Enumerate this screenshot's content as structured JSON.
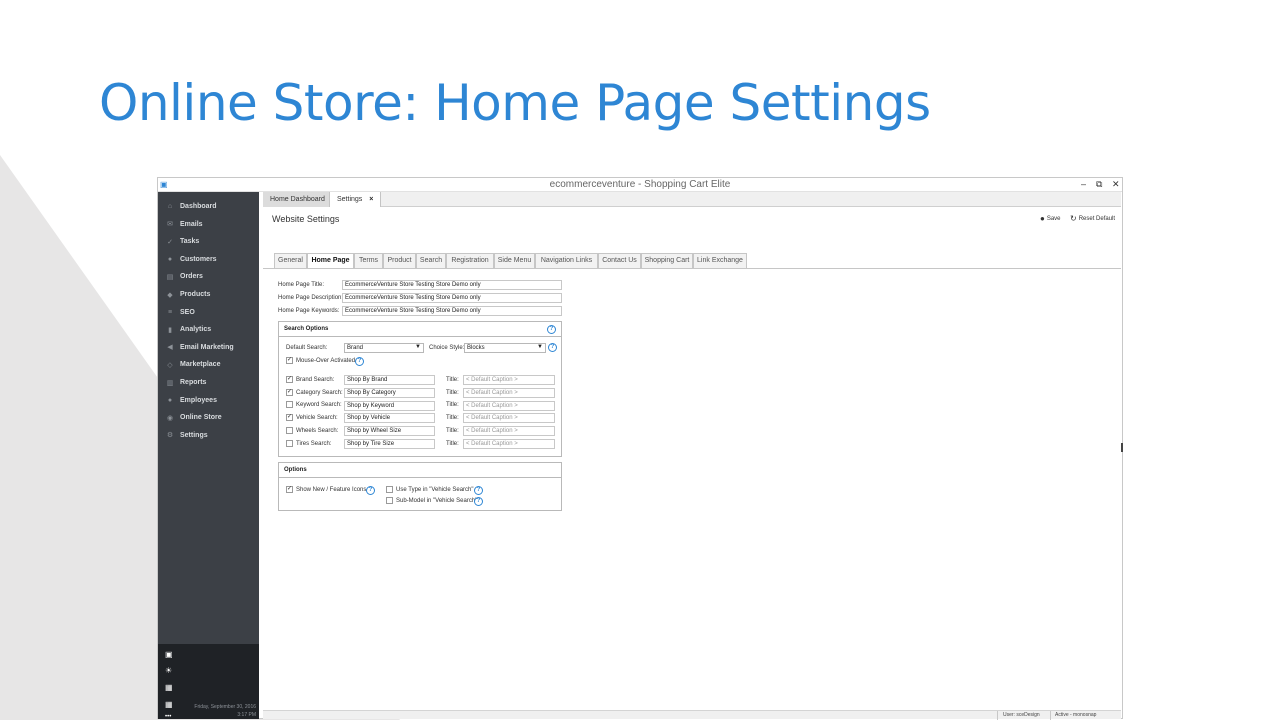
{
  "slide": {
    "title": "Online Store: Home Page Settings"
  },
  "window": {
    "title": "ecommerceventure - Shopping Cart Elite",
    "minimize": "–",
    "restore": "⧉",
    "close": "✕"
  },
  "sidebar": {
    "items": [
      {
        "label": "Dashboard",
        "icon": "dashboard-icon",
        "glyph": "⌂"
      },
      {
        "label": "Emails",
        "icon": "email-icon",
        "glyph": "✉"
      },
      {
        "label": "Tasks",
        "icon": "tasks-icon",
        "glyph": "✓"
      },
      {
        "label": "Customers",
        "icon": "customers-icon",
        "glyph": "●"
      },
      {
        "label": "Orders",
        "icon": "orders-icon",
        "glyph": "▤"
      },
      {
        "label": "Products",
        "icon": "products-icon",
        "glyph": "◆"
      },
      {
        "label": "SEO",
        "icon": "seo-icon",
        "glyph": "≡"
      },
      {
        "label": "Analytics",
        "icon": "analytics-icon",
        "glyph": "▮"
      },
      {
        "label": "Email Marketing",
        "icon": "email-marketing-icon",
        "glyph": "◀"
      },
      {
        "label": "Marketplace",
        "icon": "marketplace-icon",
        "glyph": "◇"
      },
      {
        "label": "Reports",
        "icon": "reports-icon",
        "glyph": "▥"
      },
      {
        "label": "Employees",
        "icon": "employees-icon",
        "glyph": "●"
      },
      {
        "label": "Online Store",
        "icon": "online-store-icon",
        "glyph": "◉"
      },
      {
        "label": "Settings",
        "icon": "settings-icon",
        "glyph": "⚙"
      }
    ],
    "bottom_icons": [
      {
        "icon": "windows-icon",
        "glyph": "▣"
      },
      {
        "icon": "lightbulb-icon",
        "glyph": "☀"
      },
      {
        "icon": "calculator-icon",
        "glyph": "▦"
      },
      {
        "icon": "calendar-icon",
        "glyph": "▦"
      },
      {
        "icon": "more-icon",
        "glyph": "•••"
      }
    ],
    "date": "Friday, September 30, 2016",
    "time": "3:17 PM"
  },
  "doc_tabs": [
    {
      "label": "Home Dashboard"
    },
    {
      "label": "Settings",
      "close": "×"
    }
  ],
  "page": {
    "section_title": "Website Settings",
    "save_label": "Save",
    "reset_label": "Reset Default",
    "save_icon": "save-icon",
    "reset_icon": "reset-icon"
  },
  "sub_tabs": [
    {
      "label": "General"
    },
    {
      "label": "Home Page"
    },
    {
      "label": "Terms"
    },
    {
      "label": "Product"
    },
    {
      "label": "Search"
    },
    {
      "label": "Registration"
    },
    {
      "label": "Side Menu"
    },
    {
      "label": "Navigation Links"
    },
    {
      "label": "Contact Us"
    },
    {
      "label": "Shopping Cart"
    },
    {
      "label": "Link Exchange"
    }
  ],
  "meta_fields": [
    {
      "label": "Home Page Title:",
      "value": "EcommerceVenture Store Testing Store Demo only"
    },
    {
      "label": "Home Page Description:",
      "value": "EcommerceVenture Store Testing Store Demo only"
    },
    {
      "label": "Home Page Keywords:",
      "value": "EcommerceVenture Store Testing Store Demo only"
    }
  ],
  "search_options": {
    "title": "Search Options",
    "default_search_label": "Default Search:",
    "default_search_value": "Brand",
    "choice_style_label": "Choice Style:",
    "choice_style_value": "Blocks",
    "mouseover_label": "Mouse-Over Activated",
    "mouseover_checked": "✓",
    "title_label": "Title:",
    "rows": [
      {
        "label": "Brand Search:",
        "checked": "✓",
        "value": "Shop By Brand",
        "title_placeholder": "< Default Caption >"
      },
      {
        "label": "Category Search:",
        "checked": "✓",
        "value": "Shop By Category",
        "title_placeholder": "< Default Caption >"
      },
      {
        "label": "Keyword Search:",
        "checked": "",
        "value": "Shop by Keyword",
        "title_placeholder": "< Default Caption >"
      },
      {
        "label": "Vehicle Search:",
        "checked": "✓",
        "value": "Shop by Vehicle",
        "title_placeholder": "< Default Caption >"
      },
      {
        "label": "Wheels Search:",
        "checked": "",
        "value": "Shop by Wheel Size",
        "title_placeholder": "< Default Caption >"
      },
      {
        "label": "Tires Search:",
        "checked": "",
        "value": "Shop by Tire Size",
        "title_placeholder": "< Default Caption >"
      }
    ]
  },
  "options": {
    "title": "Options",
    "show_new_label": "Show New / Feature Icons",
    "show_new_checked": "✓",
    "use_type_label": "Use Type in \"Vehicle Search\"",
    "use_type_checked": "",
    "submodel_label": "Sub-Model in \"Vehicle Search\"",
    "submodel_checked": ""
  },
  "help_glyph": "?",
  "status": {
    "user": "User: sceDesign",
    "active": "Active - monosnap"
  },
  "colors": {
    "accent": "#2e86d4",
    "sidebar_bg": "#3c4046",
    "sidebar_bottom_bg": "#1f2226",
    "deco": "#e7e6e6"
  }
}
